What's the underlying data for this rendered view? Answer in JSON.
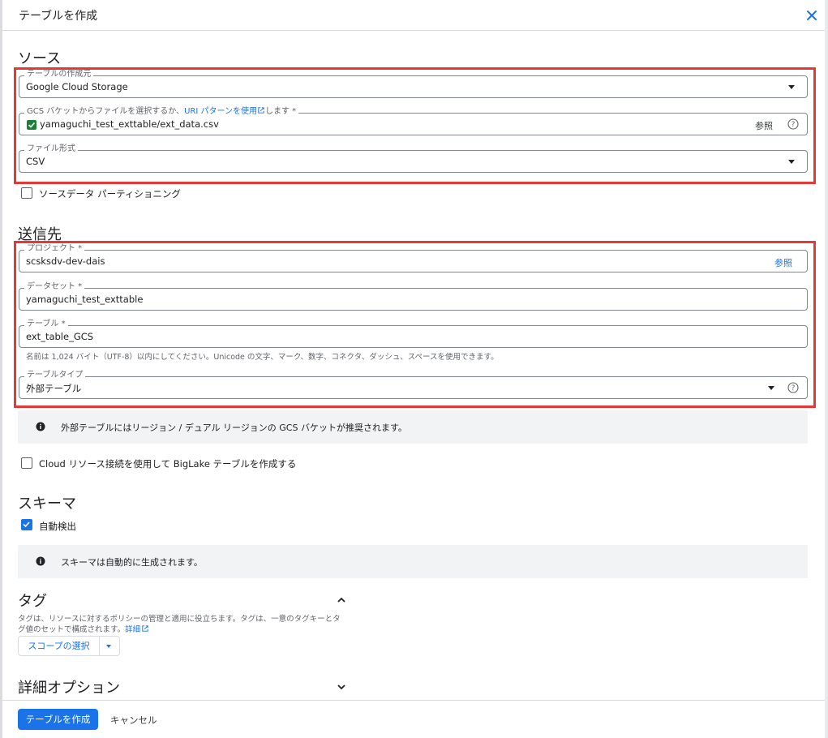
{
  "dialog": {
    "title": "テーブルを作成"
  },
  "source": {
    "heading": "ソース",
    "create_from": {
      "label": "テーブルの作成元",
      "value": "Google Cloud Storage"
    },
    "gcs": {
      "label_prefix": "GCS バケットからファイルを選択するか、",
      "label_link": "URI パターンを使用",
      "label_suffix": "します *",
      "value": "yamaguchi_test_exttable/ext_data.csv",
      "browse": "参照"
    },
    "file_format": {
      "label": "ファイル形式",
      "value": "CSV"
    },
    "partitioning": {
      "label": "ソースデータ パーティショニング",
      "checked": false
    }
  },
  "destination": {
    "heading": "送信先",
    "project": {
      "label": "プロジェクト *",
      "value": "scsksdv-dev-dais",
      "browse": "参照"
    },
    "dataset": {
      "label": "データセット *",
      "value": "yamaguchi_test_exttable"
    },
    "table": {
      "label": "テーブル *",
      "value": "ext_table_GCS",
      "hint": "名前は 1,024 バイト（UTF-8）以内にしてください。Unicode の文字、マーク、数字、コネクタ、ダッシュ、スペースを使用できます。"
    },
    "table_type": {
      "label": "テーブルタイプ",
      "value": "外部テーブル"
    },
    "info": "外部テーブルにはリージョン / デュアル リージョンの GCS バケットが推奨されます。",
    "biglake": {
      "label": "Cloud リソース接続を使用して BigLake テーブルを作成する",
      "checked": false
    }
  },
  "schema": {
    "heading": "スキーマ",
    "auto_detect": {
      "label": "自動検出",
      "checked": true
    },
    "info": "スキーマは自動的に生成されます。"
  },
  "tags": {
    "heading": "タグ",
    "desc_line1": "タグは、リソースに対するポリシーの管理と適用に役立ちます。タグは、一意のタグキーとタ",
    "desc_line2": "グ値のセットで構成されます。",
    "details_link": "詳細",
    "scope_button": "スコープの選択"
  },
  "advanced": {
    "heading": "詳細オプション"
  },
  "footer": {
    "create_button": "テーブルを作成",
    "cancel_button": "キャンセル"
  },
  "colors": {
    "accent": "#1a73e8",
    "highlight": "#e53935",
    "info_bg": "#f1f3f4"
  }
}
